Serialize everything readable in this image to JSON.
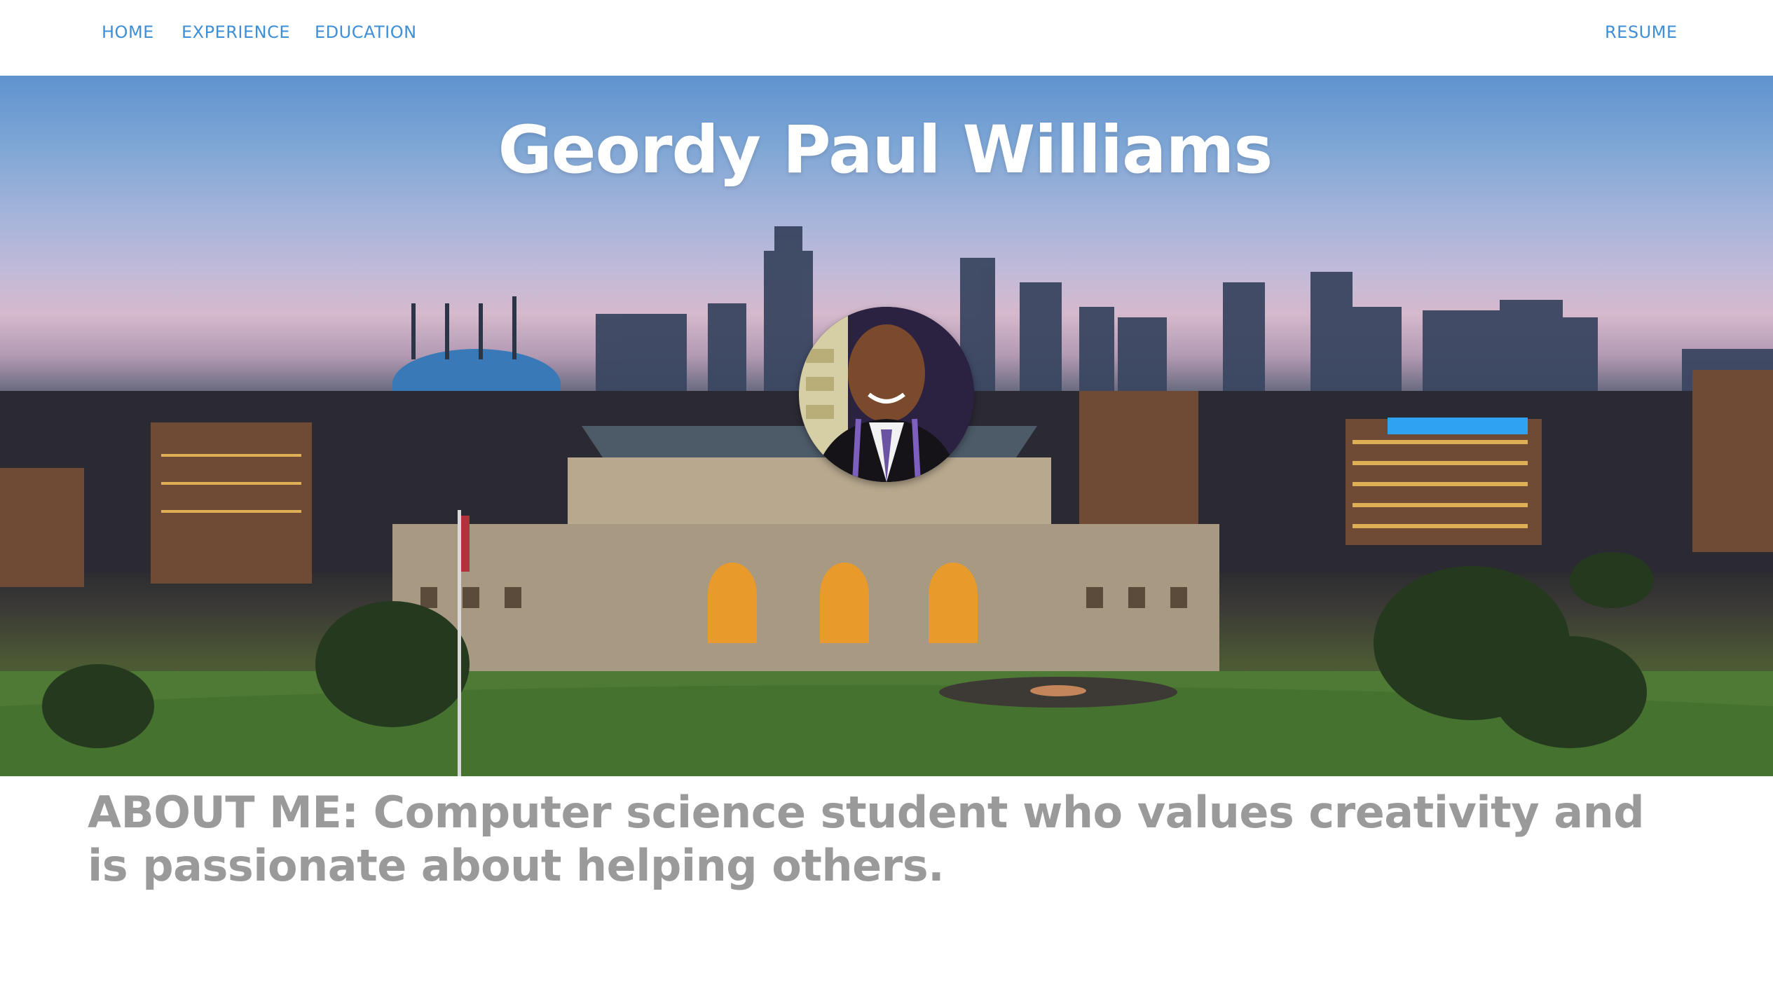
{
  "nav": {
    "home": "HOME",
    "experience": "EXPERIENCE",
    "education": "EDUCATION",
    "resume": "RESUME"
  },
  "hero": {
    "name": "Geordy Paul Williams",
    "background": "city-skyline-at-dusk-photo",
    "avatar": "profile-photo"
  },
  "about": {
    "text": "ABOUT ME: Computer science student who values creativity and is passionate about helping others."
  },
  "colors": {
    "nav_link": "#3f8fd6",
    "title": "#ffffff",
    "about_text": "#9a9a9a"
  }
}
